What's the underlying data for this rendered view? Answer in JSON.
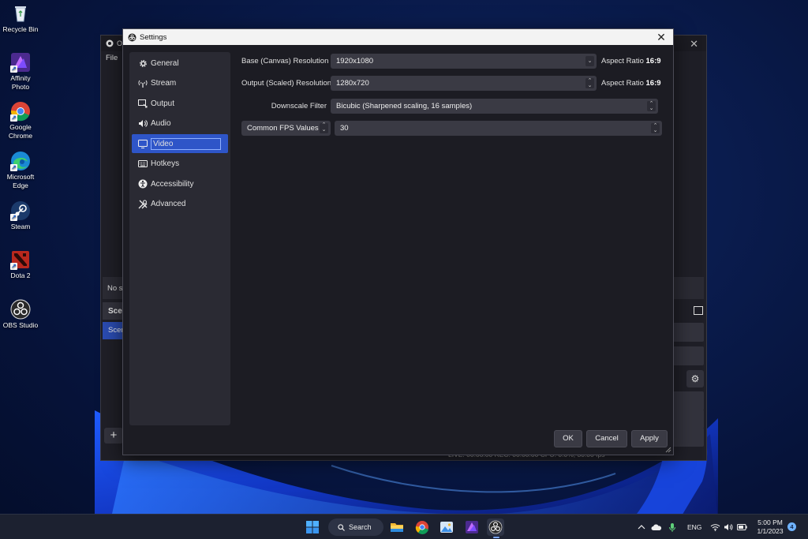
{
  "desktop": {
    "icons": [
      {
        "label": "Recycle Bin"
      },
      {
        "label": "Affinity Photo"
      },
      {
        "label": "Google Chrome"
      },
      {
        "label": "Microsoft Edge"
      },
      {
        "label": "Steam"
      },
      {
        "label": "Dota 2"
      },
      {
        "label": "OBS Studio"
      }
    ]
  },
  "obs_main": {
    "title": "O",
    "menu_file": "File",
    "no_source_text": "No s",
    "scenes_header": "Scen",
    "scene_item": "Scen",
    "add_button": "+",
    "status_text": "LIVE: 00:00:00     REC: 00:00:00     CPU: 0.0%, 30.00 fps"
  },
  "settings": {
    "title": "Settings",
    "close": "✕",
    "sidebar": [
      {
        "label": "General",
        "icon": "gear-icon"
      },
      {
        "label": "Stream",
        "icon": "antenna-icon"
      },
      {
        "label": "Output",
        "icon": "output-icon"
      },
      {
        "label": "Audio",
        "icon": "speaker-icon"
      },
      {
        "label": "Video",
        "icon": "monitor-icon",
        "active": true
      },
      {
        "label": "Hotkeys",
        "icon": "keyboard-icon"
      },
      {
        "label": "Accessibility",
        "icon": "accessibility-icon"
      },
      {
        "label": "Advanced",
        "icon": "tools-icon"
      }
    ],
    "video": {
      "base_label": "Base (Canvas) Resolution",
      "base_value": "1920x1080",
      "base_aspect_prefix": "Aspect Ratio",
      "base_aspect": "16:9",
      "output_label": "Output (Scaled) Resolution",
      "output_value": "1280x720",
      "output_aspect_prefix": "Aspect Ratio",
      "output_aspect": "16:9",
      "downscale_label": "Downscale Filter",
      "downscale_value": "Bicubic (Sharpened scaling, 16 samples)",
      "fps_type": "Common FPS Values",
      "fps_value": "30"
    },
    "buttons": {
      "ok": "OK",
      "cancel": "Cancel",
      "apply": "Apply"
    }
  },
  "taskbar": {
    "search_label": "Search",
    "language": "ENG",
    "time": "5:00 PM",
    "date": "1/1/2023",
    "notification_count": "4"
  },
  "colors": {
    "accent": "#2e55c8",
    "dialog_bg": "#1c1c23",
    "panel_bg": "#2a2a33"
  }
}
